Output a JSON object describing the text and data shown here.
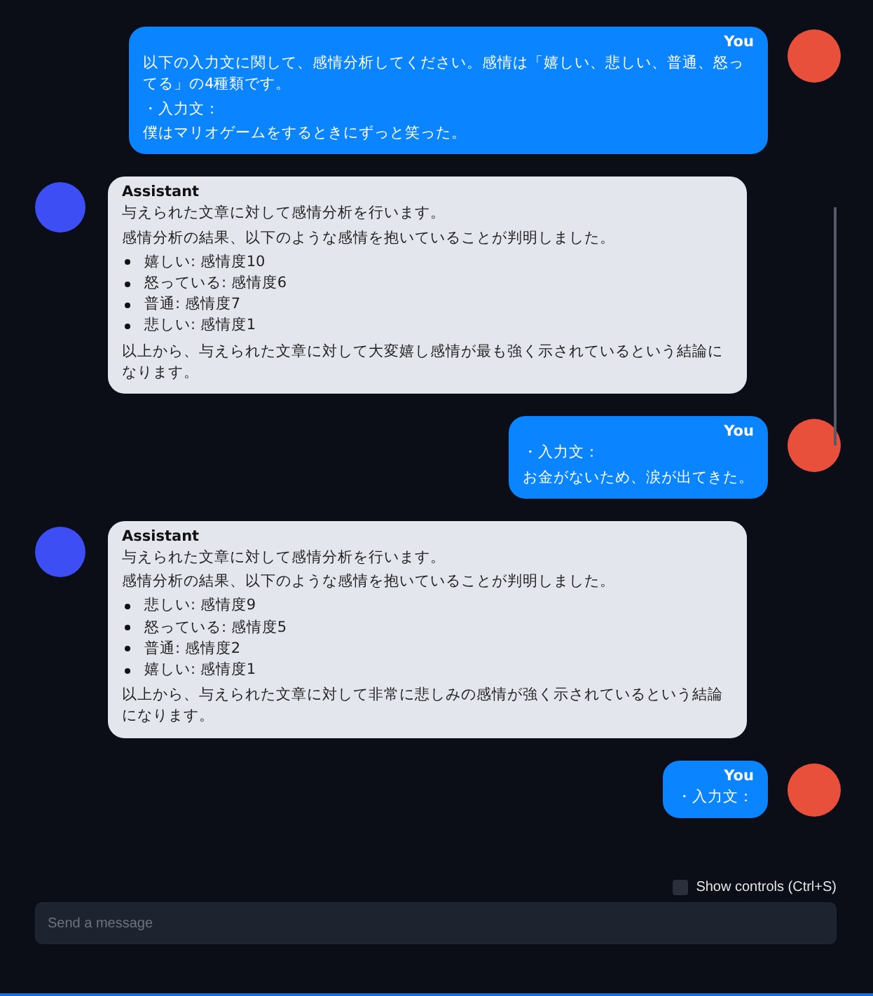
{
  "messages": [
    {
      "kind": "user",
      "author": "You",
      "blocks": [
        {
          "kind": "paragraph",
          "text": "以下の入力文に関して、感情分析してください。感情は「嬉しい、悲しい、普通、怒ってる」の4種類です。"
        },
        {
          "kind": "paragraph",
          "text": "・入力文："
        },
        {
          "kind": "paragraph",
          "text": "僕はマリオゲームをするときにずっと笑った。"
        }
      ]
    },
    {
      "kind": "assistant",
      "author": "Assistant",
      "blocks": [
        {
          "kind": "paragraph",
          "text": "与えられた文章に対して感情分析を行います。"
        },
        {
          "kind": "paragraph",
          "text": "感情分析の結果、以下のような感情を抱いていることが判明しました。"
        },
        {
          "kind": "list",
          "items": [
            "嬉しい: 感情度10",
            "怒っている: 感情度6",
            "普通: 感情度7",
            "悲しい: 感情度1"
          ]
        },
        {
          "kind": "paragraph",
          "text": "以上から、与えられた文章に対して大変嬉し感情が最も強く示されているという結論になります。"
        }
      ]
    },
    {
      "kind": "user",
      "author": "You",
      "blocks": [
        {
          "kind": "paragraph",
          "text": "・入力文："
        },
        {
          "kind": "paragraph",
          "text": "お金がないため、涙が出てきた。"
        }
      ]
    },
    {
      "kind": "assistant",
      "author": "Assistant",
      "blocks": [
        {
          "kind": "paragraph",
          "text": "与えられた文章に対して感情分析を行います。"
        },
        {
          "kind": "paragraph",
          "text": "感情分析の結果、以下のような感情を抱いていることが判明しました。"
        },
        {
          "kind": "list",
          "items": [
            "悲しい: 感情度9",
            "怒っている: 感情度5",
            "普通: 感情度2",
            "嬉しい: 感情度1"
          ]
        },
        {
          "kind": "paragraph",
          "text": "以上から、与えられた文章に対して非常に悲しみの感情が強く示されているという結論になります。"
        }
      ]
    },
    {
      "kind": "user",
      "author": "You",
      "blocks": [
        {
          "kind": "paragraph",
          "text": "・入力文："
        }
      ]
    }
  ],
  "show_controls": {
    "label": "Show controls (Ctrl+S)",
    "checked": false
  },
  "composer": {
    "placeholder": "Send a message"
  }
}
